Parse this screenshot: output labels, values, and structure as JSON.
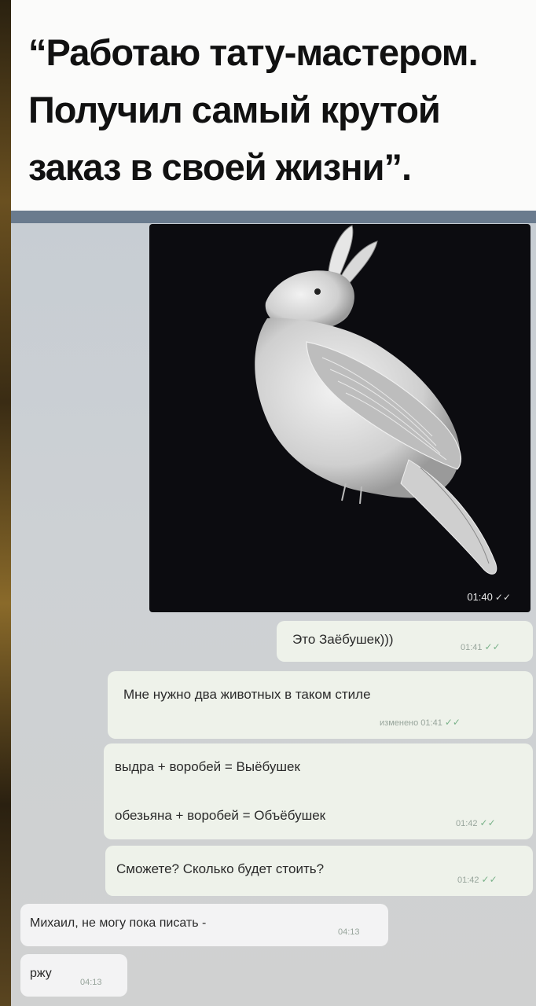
{
  "header": {
    "caption_line1": "“Работаю тату-мастером.",
    "caption_line2": "Получил самый крутой",
    "caption_line3": "заказ в своей жизни”."
  },
  "photo_message": {
    "time": "01:40"
  },
  "messages": [
    {
      "text": "Это Заёбушек)))",
      "time": "01:41",
      "status": "read"
    },
    {
      "text": "Мне нужно два животных в таком стиле",
      "meta": "изменено 01:41",
      "status": "read"
    },
    {
      "line1": "выдра + воробей = Выёбушек",
      "line2": "обезьяна + воробей = Объёбушек",
      "time": "01:42",
      "status": "read"
    },
    {
      "text": "Сможете? Сколько будет стоить?",
      "time": "01:42",
      "status": "read"
    },
    {
      "text": "Михаил, не могу пока писать -",
      "time": "04:13",
      "direction": "incoming"
    },
    {
      "text": "ржу",
      "time": "04:13",
      "direction": "incoming"
    }
  ],
  "colors": {
    "outgoing_bubble": "#eef2ea",
    "incoming_bubble": "#f3f3f4",
    "check": "#7ab28a"
  }
}
